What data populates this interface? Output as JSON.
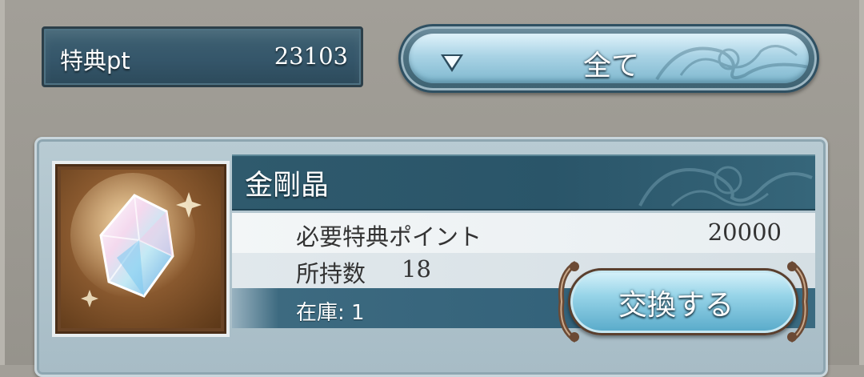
{
  "points": {
    "label": "特典pt",
    "value": "23103"
  },
  "filter": {
    "selected": "全て",
    "arrow_icon": "dropdown-arrow-icon"
  },
  "item": {
    "name": "金剛晶",
    "required_label": "必要特典ポイント",
    "required_value": "20000",
    "owned_label": "所持数",
    "owned_value": "18",
    "stock_text": "在庫: 1",
    "icon": "crystal-icon"
  },
  "exchange_button": {
    "label": "交換する"
  }
}
